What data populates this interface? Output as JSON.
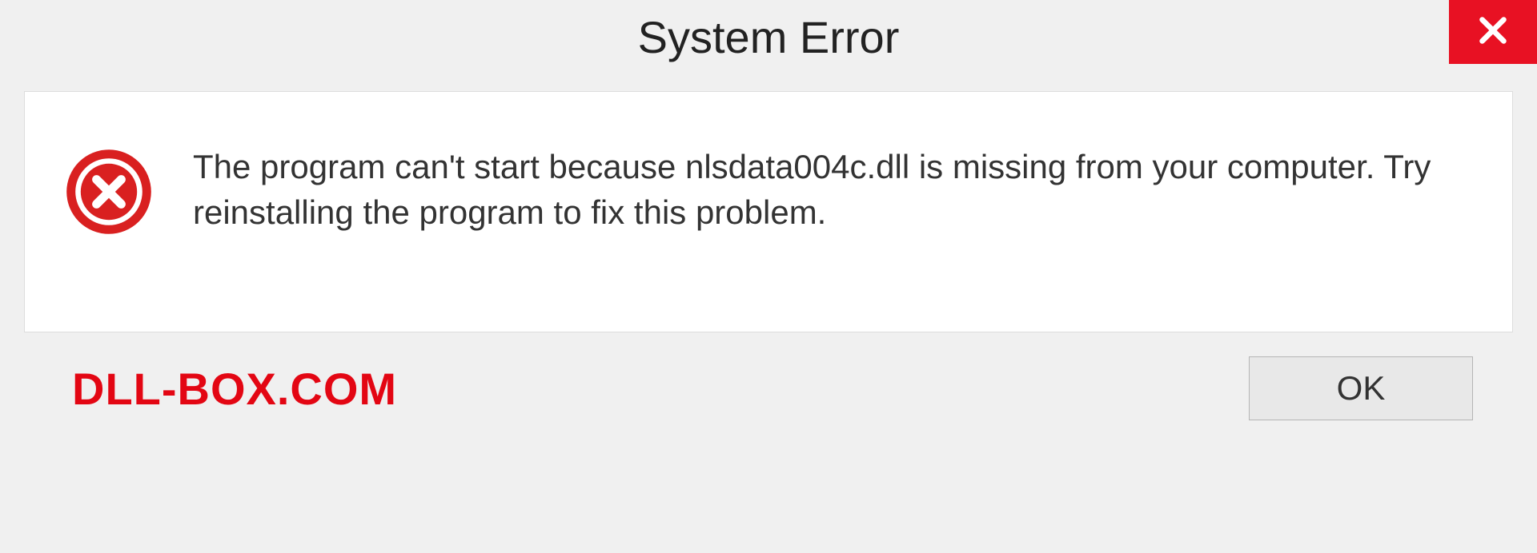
{
  "dialog": {
    "title": "System Error",
    "message": "The program can't start because nlsdata004c.dll is missing from your computer. Try reinstalling the program to fix this problem.",
    "ok_label": "OK"
  },
  "watermark": "DLL-BOX.COM",
  "icons": {
    "close": "close-icon",
    "error": "error-icon"
  }
}
